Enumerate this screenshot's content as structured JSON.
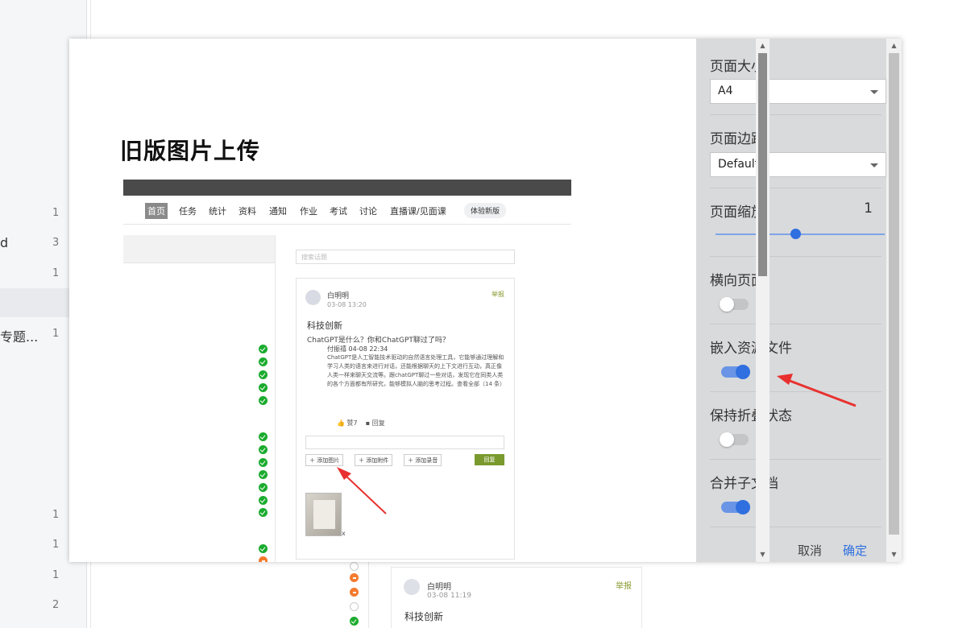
{
  "background": {
    "sidebar_items": [
      {
        "text": "",
        "count": "1"
      },
      {
        "text": "d",
        "count": "3"
      },
      {
        "text": "",
        "count": "1"
      },
      {
        "text": "专题...",
        "count": "1"
      },
      {
        "text": "",
        "count": "1"
      },
      {
        "text": "",
        "count": "1"
      },
      {
        "text": "",
        "count": "1"
      },
      {
        "text": "",
        "count": "2"
      }
    ],
    "card": {
      "name": "白明明",
      "time": "03-08 11:19",
      "report": "举报",
      "subject": "科技创新"
    },
    "status_dots": [
      "empty",
      "orange",
      "orange",
      "empty",
      "green"
    ]
  },
  "preview": {
    "title": "旧版图片上传",
    "shot": {
      "nav": [
        "首页",
        "任务",
        "统计",
        "资料",
        "通知",
        "作业",
        "考试",
        "讨论",
        "直播课/见面课"
      ],
      "nav_new": "体验新版",
      "search_placeholder": "搜索话题",
      "post": {
        "name": "白明明",
        "time": "03-08 13:20",
        "report": "举报",
        "subject": "科技创新",
        "question": "ChatGPT是什么？你和ChatGPT聊过了吗？",
        "reply_head": "付振禧 04-08 22:34",
        "reply_body": "ChatGPT是人工智能技术驱动的自然语言处理工具，它能够通过理解和学习人类的语言来进行对话，还能根据聊天的上下文进行互动，真正像人类一样来聊天交流等。跟chatGPT聊过一些对话，发现它在同类人类的各个方面都有所研究，能够模拟人脑的思考过程。查看全部（14 条）",
        "like": "赞7",
        "reply": "回复",
        "buttons": [
          "添加图片",
          "添加附件",
          "添加录音"
        ],
        "submit": "回复",
        "thumb_close": "x"
      },
      "status_dots": [
        "green",
        "green",
        "green",
        "green",
        "green",
        "green",
        "green",
        "green",
        "green",
        "green",
        "green",
        "green",
        "green",
        "orange",
        "orange",
        "orange",
        "empty"
      ]
    }
  },
  "panel": {
    "page_size_label": "页面大小",
    "page_size_value": "A4",
    "margin_label": "页面边距",
    "margin_value": "Default",
    "scale_label": "页面缩放",
    "scale_value": "1",
    "scale_fraction": 0.47,
    "landscape_label": "横向页面",
    "landscape_on": false,
    "embed_label": "嵌入资源文件",
    "embed_on": true,
    "keep_fold_label": "保持折叠状态",
    "keep_fold_on": false,
    "merge_label": "合并子文档",
    "merge_on": true,
    "cancel": "取消",
    "ok": "确定"
  },
  "colors": {
    "accent": "#2f6fe0",
    "annotation_arrow": "#e8312f",
    "panel_bg": "#d9dadc",
    "success": "#1bab2e",
    "warning": "#f47a2e"
  }
}
